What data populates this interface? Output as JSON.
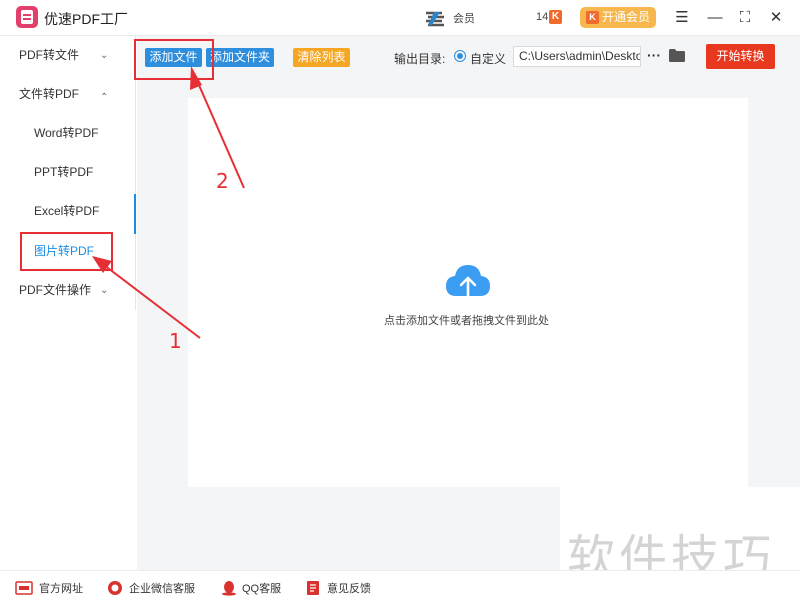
{
  "app": {
    "title": "优速PDF工厂"
  },
  "user": {
    "name": "会员",
    "id": "14",
    "vip_tag": "K",
    "vip_button": "开通会员"
  },
  "window": {
    "minimize": "—",
    "maximize": "⛶",
    "close": "✕",
    "menu": "☰"
  },
  "sidebar": {
    "items": [
      {
        "label": "PDF转文件",
        "chevron": "⌄"
      },
      {
        "label": "文件转PDF",
        "chevron": "⌃"
      },
      {
        "label": "Word转PDF"
      },
      {
        "label": "PPT转PDF"
      },
      {
        "label": "Excel转PDF"
      },
      {
        "label": "图片转PDF",
        "active": true
      },
      {
        "label": "PDF文件操作",
        "chevron": "⌄"
      }
    ]
  },
  "toolbar": {
    "add_file": "添加文件",
    "add_folder": "添加文件夹",
    "clear_list": "清除列表",
    "output_label": "输出目录:",
    "custom_label": "自定义",
    "path_value": "C:\\Users\\admin\\Deskto",
    "more": "···",
    "start": "开始转换"
  },
  "dropzone": {
    "hint": "点击添加文件或者拖拽文件到此处"
  },
  "annotations": {
    "step1": "1",
    "step2": "2"
  },
  "watermark": "软件技巧",
  "footer": {
    "links": [
      "官方网址",
      "企业微信客服",
      "QQ客服",
      "意见反馈"
    ]
  },
  "colors": {
    "accent": "#2e8ede",
    "start": "#e8381f",
    "clear": "#f5a623",
    "annotation": "#e52f35"
  }
}
